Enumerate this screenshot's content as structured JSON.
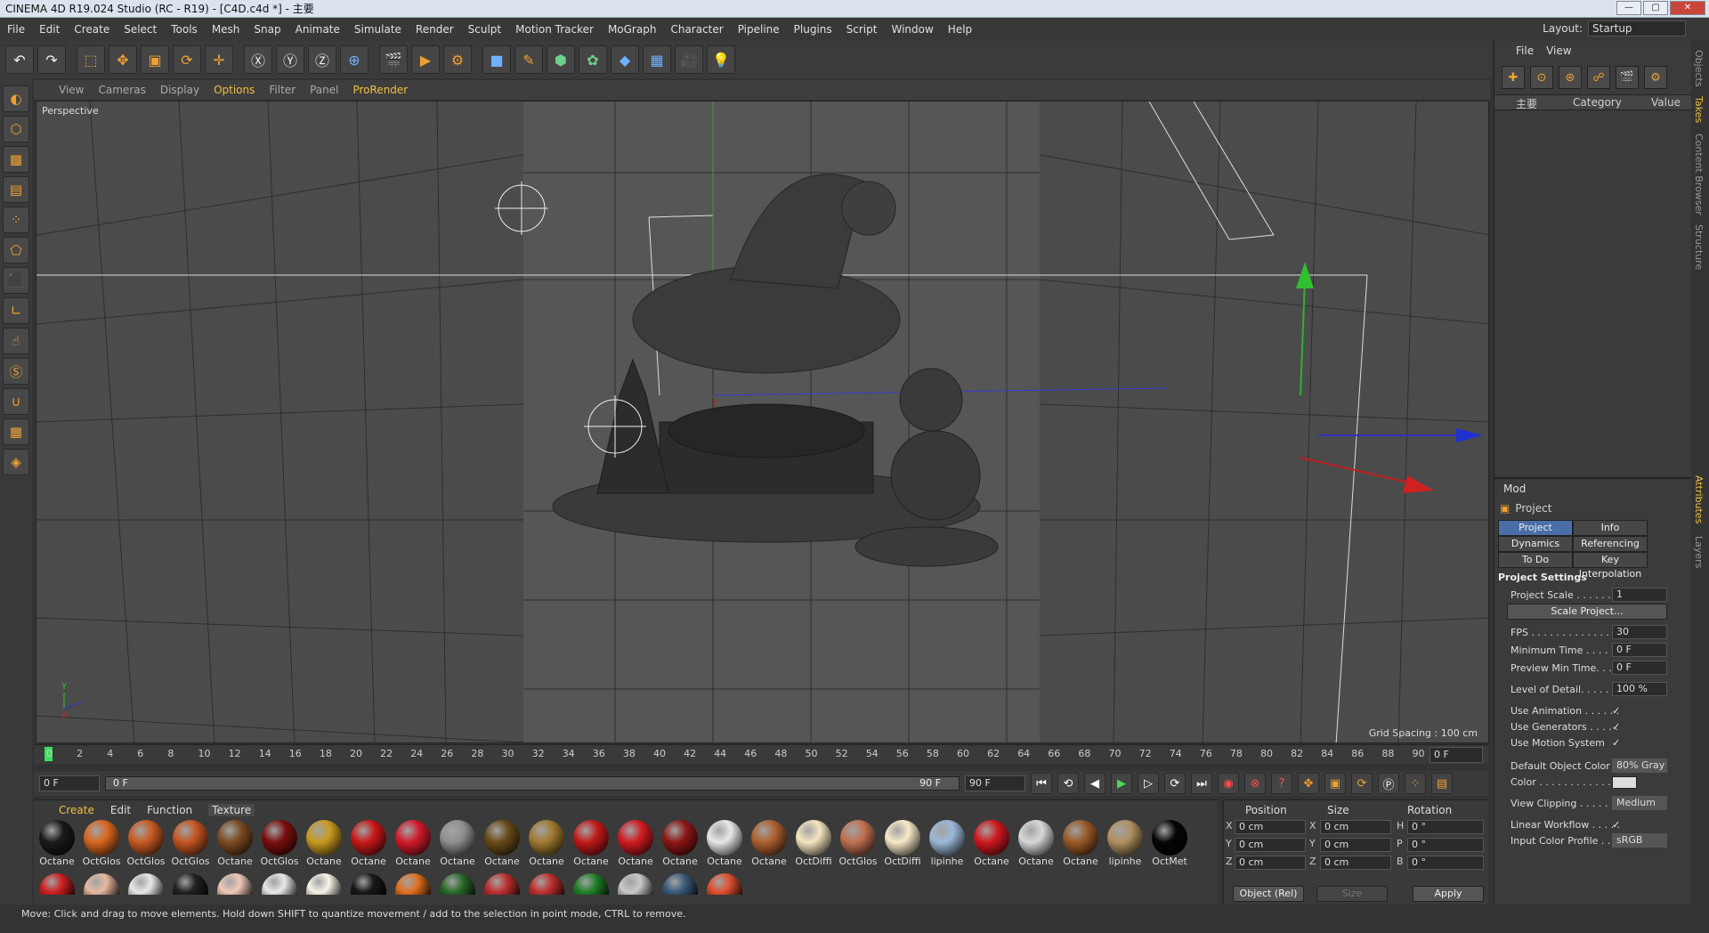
{
  "window": {
    "title": "CINEMA 4D R19.024 Studio (RC - R19) - [C4D.c4d *] - 主要",
    "min": "—",
    "max": "▢",
    "close": "✕"
  },
  "menu": [
    "File",
    "Edit",
    "Create",
    "Select",
    "Tools",
    "Mesh",
    "Snap",
    "Animate",
    "Simulate",
    "Render",
    "Sculpt",
    "Motion Tracker",
    "MoGraph",
    "Character",
    "Pipeline",
    "Plugins",
    "Script",
    "Window",
    "Help"
  ],
  "layout": {
    "label": "Layout:",
    "value": "Startup"
  },
  "viewport_menu": {
    "items": [
      "View",
      "Cameras",
      "Display",
      "Options",
      "Filter",
      "Panel",
      "ProRender"
    ]
  },
  "viewport": {
    "name": "Perspective",
    "grid_spacing": "Grid Spacing : 100 cm"
  },
  "timeline": {
    "ticks": [
      "0",
      "2",
      "4",
      "6",
      "8",
      "10",
      "12",
      "14",
      "16",
      "18",
      "20",
      "22",
      "24",
      "26",
      "28",
      "30",
      "32",
      "34",
      "36",
      "38",
      "40",
      "42",
      "44",
      "46",
      "48",
      "50",
      "52",
      "54",
      "56",
      "58",
      "60",
      "62",
      "64",
      "66",
      "68",
      "70",
      "72",
      "74",
      "76",
      "78",
      "80",
      "82",
      "84",
      "86",
      "88",
      "90"
    ],
    "current": "0 F"
  },
  "timecontrols": {
    "start": "0 F",
    "slider_start": "0 F",
    "slider_end": "90 F",
    "end": "90 F"
  },
  "material_menu": [
    "Create",
    "Edit",
    "Function",
    "Texture"
  ],
  "materials_row1": [
    {
      "name": "Octane",
      "color": "#1a1a1a"
    },
    {
      "name": "OctGlos",
      "color": "#d9661f"
    },
    {
      "name": "OctGlos",
      "color": "#c85a22"
    },
    {
      "name": "OctGlos",
      "color": "#c45522"
    },
    {
      "name": "Octane",
      "color": "#7a4a22"
    },
    {
      "name": "OctGlos",
      "color": "#7a0e0e"
    },
    {
      "name": "Octane",
      "color": "#c89a20"
    },
    {
      "name": "Octane",
      "color": "#c81818"
    },
    {
      "name": "Octane",
      "color": "#d01b2a"
    },
    {
      "name": "Octane",
      "color": "#8f8f8f"
    },
    {
      "name": "Octane",
      "color": "#6a4a18"
    },
    {
      "name": "Octane",
      "color": "#a07a30"
    },
    {
      "name": "Octane",
      "color": "#c21a1a"
    },
    {
      "name": "Octane",
      "color": "#cf1c22"
    },
    {
      "name": "Octane",
      "color": "#8e1616"
    },
    {
      "name": "Octane",
      "color": "#e8e8e8"
    },
    {
      "name": "Octane",
      "color": "#b06030"
    },
    {
      "name": "OctDiffi",
      "color": "#f5e6c0"
    },
    {
      "name": "OctGlos",
      "color": "#c07050"
    },
    {
      "name": "OctDiffi",
      "color": "#f8eac8"
    },
    {
      "name": "lipinhe",
      "color": "#9ab8d8"
    },
    {
      "name": "Octane",
      "color": "#d01820"
    },
    {
      "name": "Octane",
      "color": "#d8d8d8"
    },
    {
      "name": "Octane",
      "color": "#9a5a28"
    },
    {
      "name": "lipinhe",
      "color": "#b09060"
    },
    {
      "name": "OctMet",
      "color": "#050505"
    }
  ],
  "materials_row2": [
    {
      "color": "#d02020"
    },
    {
      "color": "#e8b8a0"
    },
    {
      "color": "#e8e8e8"
    },
    {
      "color": "#222222"
    },
    {
      "color": "#f0c8b8"
    },
    {
      "color": "#e8e8e8"
    },
    {
      "color": "#f8f4e8"
    },
    {
      "color": "#181818"
    },
    {
      "color": "#e07020"
    },
    {
      "color": "#2a6a2a"
    },
    {
      "color": "#c03030"
    },
    {
      "color": "#c03030"
    },
    {
      "color": "#20802a"
    },
    {
      "color": "#c8c8c8"
    },
    {
      "color": "#3a5a7a"
    },
    {
      "color": "#e05030"
    }
  ],
  "coords": {
    "position": "Position",
    "size": "Size",
    "rotation": "Rotation",
    "rows": [
      {
        "axis": "X",
        "pos": "0 cm",
        "saxis": "X",
        "size": "0 cm",
        "raxis": "H",
        "rot": "0 °"
      },
      {
        "axis": "Y",
        "pos": "0 cm",
        "saxis": "Y",
        "size": "0 cm",
        "raxis": "P",
        "rot": "0 °"
      },
      {
        "axis": "Z",
        "pos": "0 cm",
        "saxis": "Z",
        "size": "0 cm",
        "raxis": "B",
        "rot": "0 °"
      }
    ],
    "mode": "Object (Rel)",
    "size_mode": "Size",
    "apply": "Apply"
  },
  "status": "Move: Click and drag to move elements. Hold down SHIFT to quantize movement / add to the selection in point mode, CTRL to remove.",
  "object_manager": {
    "menu": [
      "File",
      "View"
    ],
    "col_name": "主要",
    "col_category": "Category",
    "col_value": "Value"
  },
  "attributes": {
    "mode": "Mod",
    "object": "Project",
    "tabs": [
      "Project Settings",
      "Info",
      "Dynamics",
      "Referencing",
      "To Do",
      "Key Interpolation"
    ],
    "section": "Project Settings",
    "project_scale_label": "Project Scale . . . . . . .",
    "project_scale": "1",
    "scale_btn": "Scale Project...",
    "fps_label": "FPS . . . . . . . . . . . . . . .",
    "fps": "30",
    "min_time_label": "Minimum Time . . . . .",
    "min_time": "0 F",
    "preview_min_label": "Preview Min Time. . .",
    "preview_min": "0 F",
    "lod_label": "Level of Detail. . . . . .",
    "lod": "100 %",
    "use_anim_label": "Use Animation . . . . . .",
    "use_gen_label": "Use Generators . . . . .",
    "use_motion_label": "Use Motion System",
    "check": "✓",
    "def_color_label": "Default Object Color",
    "def_color": "80% Gray",
    "color_label": "Color . . . . . . . . . . . .",
    "view_clip_label": "View Clipping . . . . . . .",
    "view_clip": "Medium",
    "linear_label": "Linear Workflow . . . . .",
    "input_profile_label": "Input Color Profile . .",
    "input_profile": "sRGB"
  },
  "side_tabs": [
    "Objects",
    "Takes",
    "Content Browser",
    "Structure",
    "Attributes",
    "Layers"
  ]
}
